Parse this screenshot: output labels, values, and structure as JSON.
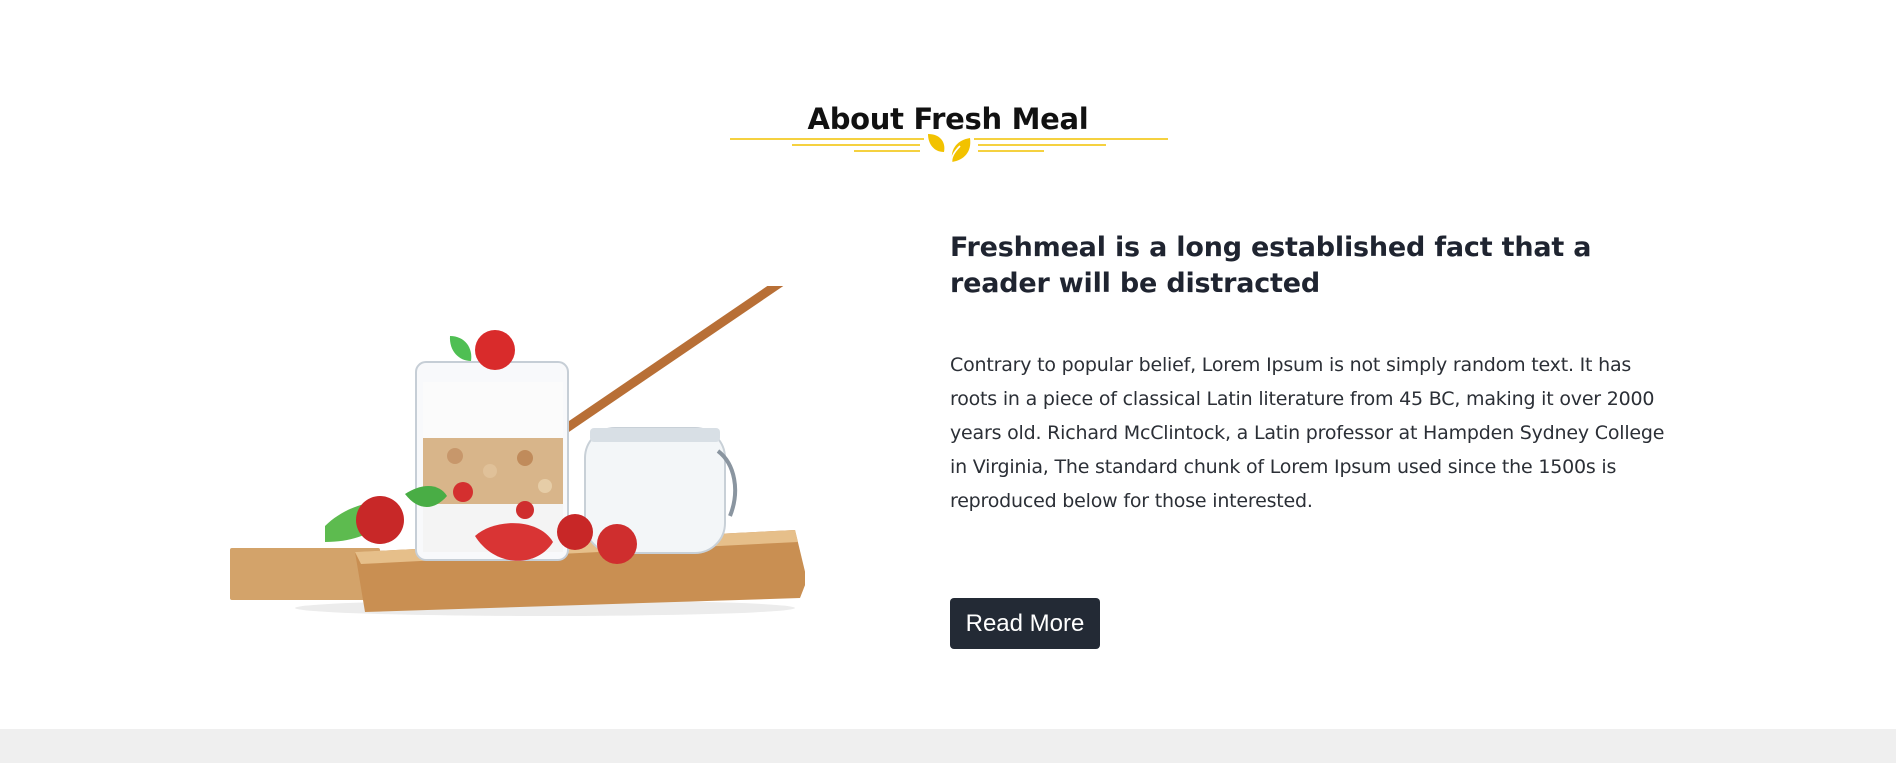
{
  "about": {
    "title": "About Fresh Meal",
    "divider_icon": "leaf-icon",
    "image": "parfait-with-strawberries-image",
    "heading": "Freshmeal is a long established fact that a reader will be distracted",
    "body": "Contrary to popular belief, Lorem Ipsum is not simply random text. It has roots in a piece of classical Latin literature from 45 BC, making it over 2000 years old. Richard McClintock, a Latin professor at Hampden Sydney College in Virginia, The standard chunk of Lorem Ipsum used since the 1500s is reproduced below for those interested.",
    "button_label": "Read More"
  },
  "colors": {
    "accent": "#f2c200",
    "button_bg": "#232a35",
    "heading": "#1f2430",
    "footer_bg": "#efefef"
  }
}
